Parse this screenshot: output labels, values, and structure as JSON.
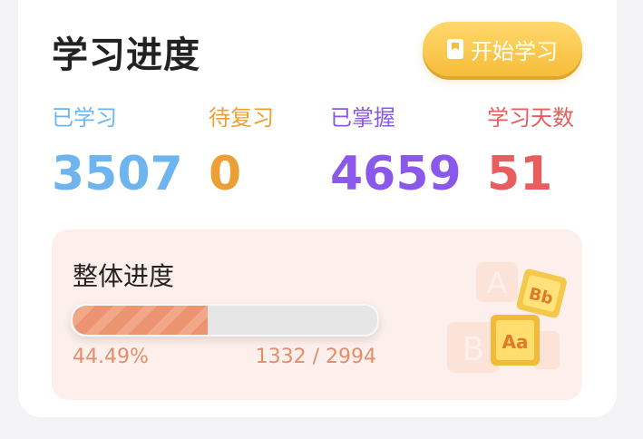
{
  "header": {
    "title": "学习进度",
    "start_button_label": "开始学习"
  },
  "stats": [
    {
      "label": "已学习",
      "value": "3507"
    },
    {
      "label": "待复习",
      "value": "0"
    },
    {
      "label": "已掌握",
      "value": "4659"
    },
    {
      "label": "学习天数",
      "value": "51"
    }
  ],
  "progress": {
    "title": "整体进度",
    "fraction": 0.4449,
    "percent_text": "44.49%",
    "count_text": "1332 / 2994"
  },
  "decor": {
    "block_top_text": "Bb",
    "block_bottom_text": "Aa"
  },
  "colors": {
    "learned": "#6eb5ef",
    "review": "#ec9f35",
    "mastered": "#8a58ea",
    "days": "#e85d5d",
    "button": "#f6bd3a",
    "progress": "#ec9472"
  },
  "icons": {
    "start_button": "book-icon",
    "decoration": "letter-blocks-icon"
  }
}
